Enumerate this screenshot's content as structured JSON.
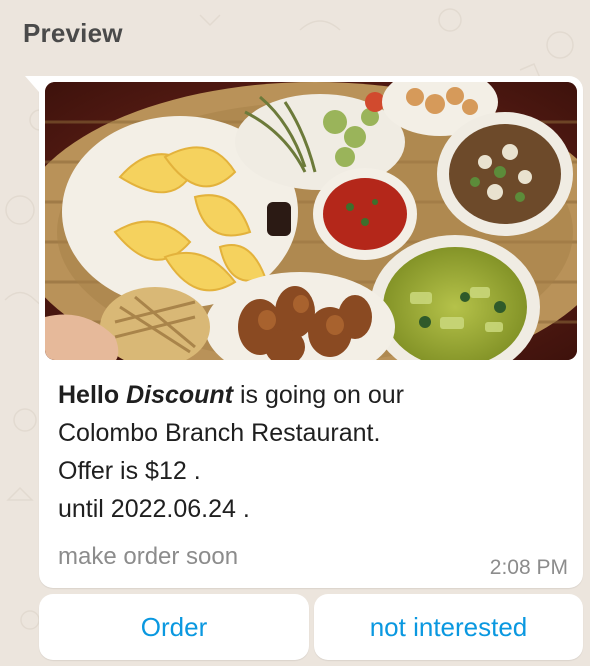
{
  "header": {
    "title": "Preview"
  },
  "message": {
    "greeting": "Hello",
    "highlight": "Discount",
    "line1_rest": " is going on our",
    "line2": "Colombo Branch Restaurant.",
    "line3": "Offer is $12 .",
    "line4": "until 2022.06.24 .",
    "footer": "make order soon",
    "time": "2:08 PM"
  },
  "buttons": {
    "order": "Order",
    "not_interested": "not interested"
  },
  "colors": {
    "background": "#ece5dd",
    "bubble": "#ffffff",
    "button_text": "#0a98e0",
    "meta_text": "#8c8c8c"
  }
}
